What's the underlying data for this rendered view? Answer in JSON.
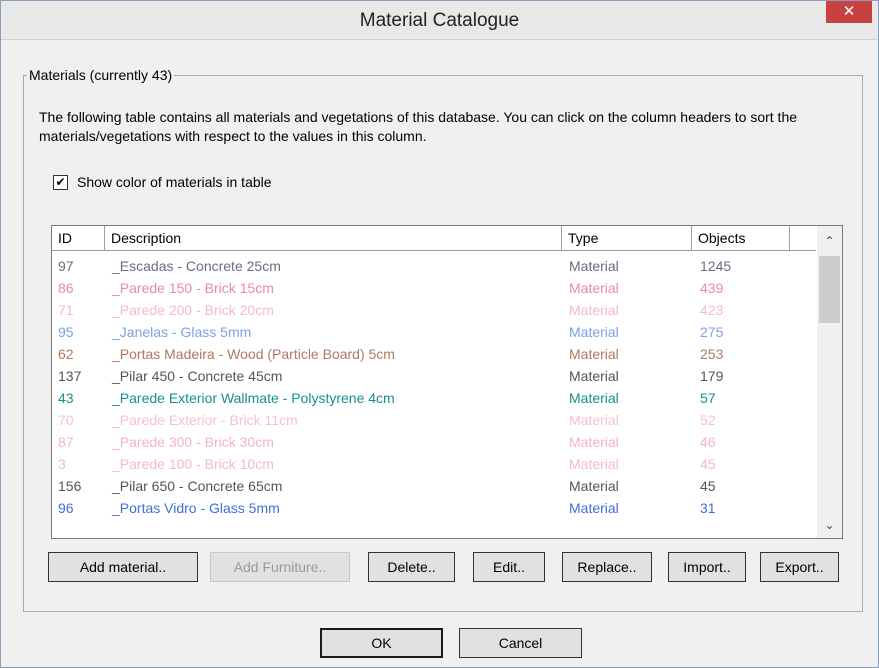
{
  "window": {
    "title": "Material Catalogue",
    "close_glyph": "✕"
  },
  "group": {
    "legend": "Materials (currently 43)"
  },
  "description": "The following table contains all materials and vegetations of this database. You can click on the column headers to sort the materials/vegetations with respect to the values in this column.",
  "show_color": {
    "label": "Show color of materials in table",
    "checked": true,
    "check_glyph": "✔"
  },
  "table": {
    "columns": [
      "ID",
      "Description",
      "Type",
      "Objects"
    ],
    "rows": [
      {
        "id": "97",
        "description": "_Escadas - Concrete 25cm",
        "type": "Material",
        "objects": "1245",
        "color": "#6d6a86"
      },
      {
        "id": "86",
        "description": "_Parede 150 - Brick 15cm",
        "type": "Material",
        "objects": "439",
        "color": "#e889a8"
      },
      {
        "id": "71",
        "description": "_Parede 200 - Brick 20cm",
        "type": "Material",
        "objects": "423",
        "color": "#f5b8cf"
      },
      {
        "id": "95",
        "description": "_Janelas - Glass 5mm",
        "type": "Material",
        "objects": "275",
        "color": "#7fa0e6"
      },
      {
        "id": "62",
        "description": "_Portas Madeira - Wood (Particle Board) 5cm",
        "type": "Material",
        "objects": "253",
        "color": "#b07860"
      },
      {
        "id": "137",
        "description": "_Pilar 450 - Concrete 45cm",
        "type": "Material",
        "objects": "179",
        "color": "#555555"
      },
      {
        "id": "43",
        "description": "_Parede Exterior Wallmate - Polystyrene 4cm",
        "type": "Material",
        "objects": "57",
        "color": "#178f8f"
      },
      {
        "id": "70",
        "description": "_Parede Exterior - Brick 11cm",
        "type": "Material",
        "objects": "52",
        "color": "#f7c0d2"
      },
      {
        "id": "87",
        "description": "_Parede 300 - Brick 30cm",
        "type": "Material",
        "objects": "46",
        "color": "#f3b2c8"
      },
      {
        "id": "3",
        "description": "_Parede 100 - Brick 10cm",
        "type": "Material",
        "objects": "45",
        "color": "#f5b8cd"
      },
      {
        "id": "156",
        "description": "_Pilar 650 - Concrete 65cm",
        "type": "Material",
        "objects": "45",
        "color": "#555555"
      },
      {
        "id": "96",
        "description": "_Portas Vidro - Glass 5mm",
        "type": "Material",
        "objects": "31",
        "color": "#3f6fd8"
      }
    ]
  },
  "buttons": {
    "add_material": "Add material..",
    "add_furniture": "Add Furniture..",
    "delete": "Delete..",
    "edit": "Edit..",
    "replace": "Replace..",
    "import": "Import..",
    "export": "Export..",
    "ok": "OK",
    "cancel": "Cancel"
  },
  "scrollbar": {
    "up_glyph": "⌃",
    "down_glyph": "⌄"
  }
}
